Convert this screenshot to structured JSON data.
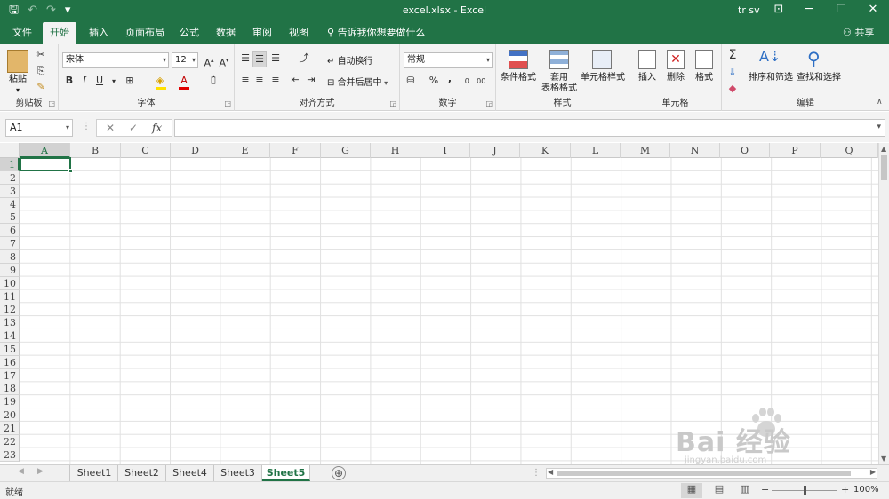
{
  "titlebar": {
    "title": "excel.xlsx  -  Excel",
    "user": "tr sv",
    "qat": [
      {
        "icon": "save-icon",
        "glyph": "🖫"
      },
      {
        "icon": "undo-icon",
        "glyph": "↶"
      },
      {
        "icon": "redo-icon",
        "glyph": "↷"
      },
      {
        "icon": "customize-qat-icon",
        "glyph": "▾"
      }
    ]
  },
  "tabs": {
    "items": [
      "文件",
      "开始",
      "插入",
      "页面布局",
      "公式",
      "数据",
      "审阅",
      "视图"
    ],
    "active": "开始",
    "tell_me": "告诉我你想要做什么",
    "share": "共享"
  },
  "ribbon": {
    "clipboard": {
      "label": "剪贴板",
      "paste": "粘贴"
    },
    "font": {
      "label": "字体",
      "font_name": "宋体",
      "font_size": "12",
      "bold": "B",
      "italic": "I",
      "underline": "U"
    },
    "alignment": {
      "label": "对齐方式",
      "wrap": "自动换行",
      "merge": "合并后居中"
    },
    "number": {
      "label": "数字",
      "format": "常规",
      "percent": "%",
      "comma": ","
    },
    "styles": {
      "label": "样式",
      "conditional": "条件格式",
      "table_line1": "套用",
      "table_line2": "表格格式",
      "cell_styles": "单元格样式"
    },
    "cells": {
      "label": "单元格",
      "insert": "插入",
      "delete": "删除",
      "format": "格式"
    },
    "editing": {
      "label": "编辑",
      "sort": "排序和筛选",
      "find": "查找和选择"
    }
  },
  "formula_bar": {
    "name_box": "A1",
    "cancel": "✕",
    "enter": "✓",
    "fx": "fx",
    "value": ""
  },
  "grid": {
    "columns": [
      "A",
      "B",
      "C",
      "D",
      "E",
      "F",
      "G",
      "H",
      "I",
      "J",
      "K",
      "L",
      "M",
      "N",
      "O",
      "P",
      "Q"
    ],
    "rows": [
      "1",
      "2",
      "3",
      "4",
      "5",
      "6",
      "7",
      "8",
      "9",
      "10",
      "11",
      "12",
      "13",
      "14",
      "15",
      "16",
      "17",
      "18",
      "19",
      "20",
      "21",
      "22",
      "23"
    ],
    "active_cell": "A1"
  },
  "sheets": {
    "tabs": [
      "Sheet1",
      "Sheet2",
      "Sheet4",
      "Sheet3",
      "Sheet5"
    ],
    "active": "Sheet5",
    "add": "⊕"
  },
  "status": {
    "ready": "就绪",
    "zoom": "100%",
    "zoom_minus": "−",
    "zoom_plus": "+"
  },
  "watermark": {
    "brand": "Bai 经验",
    "site": "jingyan.baidu.com"
  },
  "colors": {
    "accent": "#217346",
    "ribbon_bg": "#f3f3f3",
    "grid_line": "#e1e1e1"
  }
}
